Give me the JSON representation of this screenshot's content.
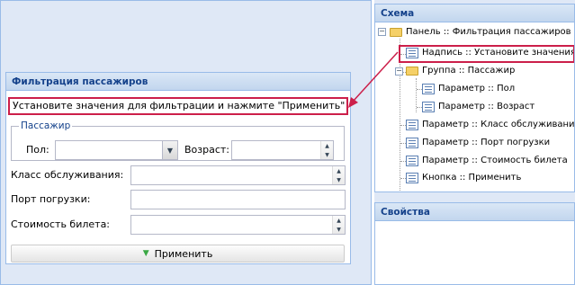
{
  "filter_panel": {
    "title": "Фильтрация пассажиров",
    "notice": "Установите значения для фильтрации и нажмите \"Применить\"",
    "group": {
      "legend": "Пассажир",
      "sex_label": "Пол:",
      "sex_value": "",
      "age_label": "Возраст:",
      "age_value": ""
    },
    "class_label": "Класс обслуживания:",
    "class_value": "",
    "port_label": "Порт погрузки:",
    "port_value": "",
    "price_label": "Стоимость билета:",
    "price_value": "",
    "apply_label": "Применить"
  },
  "schema_panel": {
    "title": "Схема",
    "nodes": [
      {
        "label": "Панель :: Фильтрация пассажиров",
        "icon": "folder-icon"
      },
      {
        "label": "Надпись :: Установите значения ...",
        "icon": "item-icon"
      },
      {
        "label": "Группа :: Пассажир",
        "icon": "folder-icon"
      },
      {
        "label": "Параметр :: Пол",
        "icon": "item-icon"
      },
      {
        "label": "Параметр :: Возраст",
        "icon": "item-icon"
      },
      {
        "label": "Параметр :: Класс обслуживания",
        "icon": "item-icon"
      },
      {
        "label": "Параметр :: Порт погрузки",
        "icon": "item-icon"
      },
      {
        "label": "Параметр :: Стоимость билета",
        "icon": "item-icon"
      },
      {
        "label": "Кнопка :: Применить",
        "icon": "item-icon"
      }
    ]
  },
  "properties_panel": {
    "title": "Свойства"
  },
  "colors": {
    "highlight": "#cc1f4a",
    "header_text": "#15428b",
    "panel_border": "#99bbe8",
    "workspace_bg": "#dfe8f6"
  }
}
